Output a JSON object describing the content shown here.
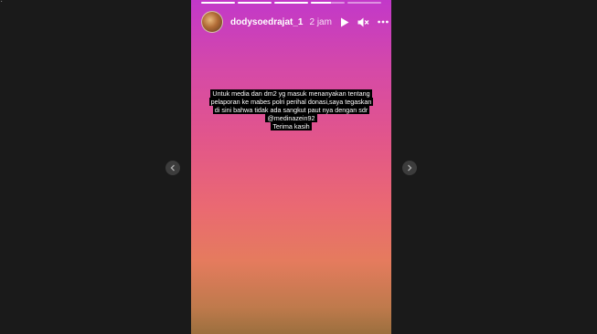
{
  "story": {
    "progress": [
      1,
      1,
      1,
      0.6,
      0
    ],
    "username": "dodysoedrajat_1",
    "time_ago": "2 jam",
    "caption_lines": [
      "Untuk media dan dm2 yg masuk menanyakan tentang",
      "pelaporan ke mabes polri perihal donasi,saya tegaskan",
      "di sini bahwa tidak ada sangkut paut nya dengan sdr",
      "@medinazein92",
      "Terima kasih"
    ]
  },
  "icons": {
    "play": "play-icon",
    "mute": "speaker-muted-icon",
    "more": "more-icon",
    "prev": "chevron-left-icon",
    "next": "chevron-right-icon"
  },
  "colors": {
    "page_bg": "#1a1a1a",
    "gradient_top": "#c238c9",
    "gradient_bottom": "#9b6f3e"
  }
}
